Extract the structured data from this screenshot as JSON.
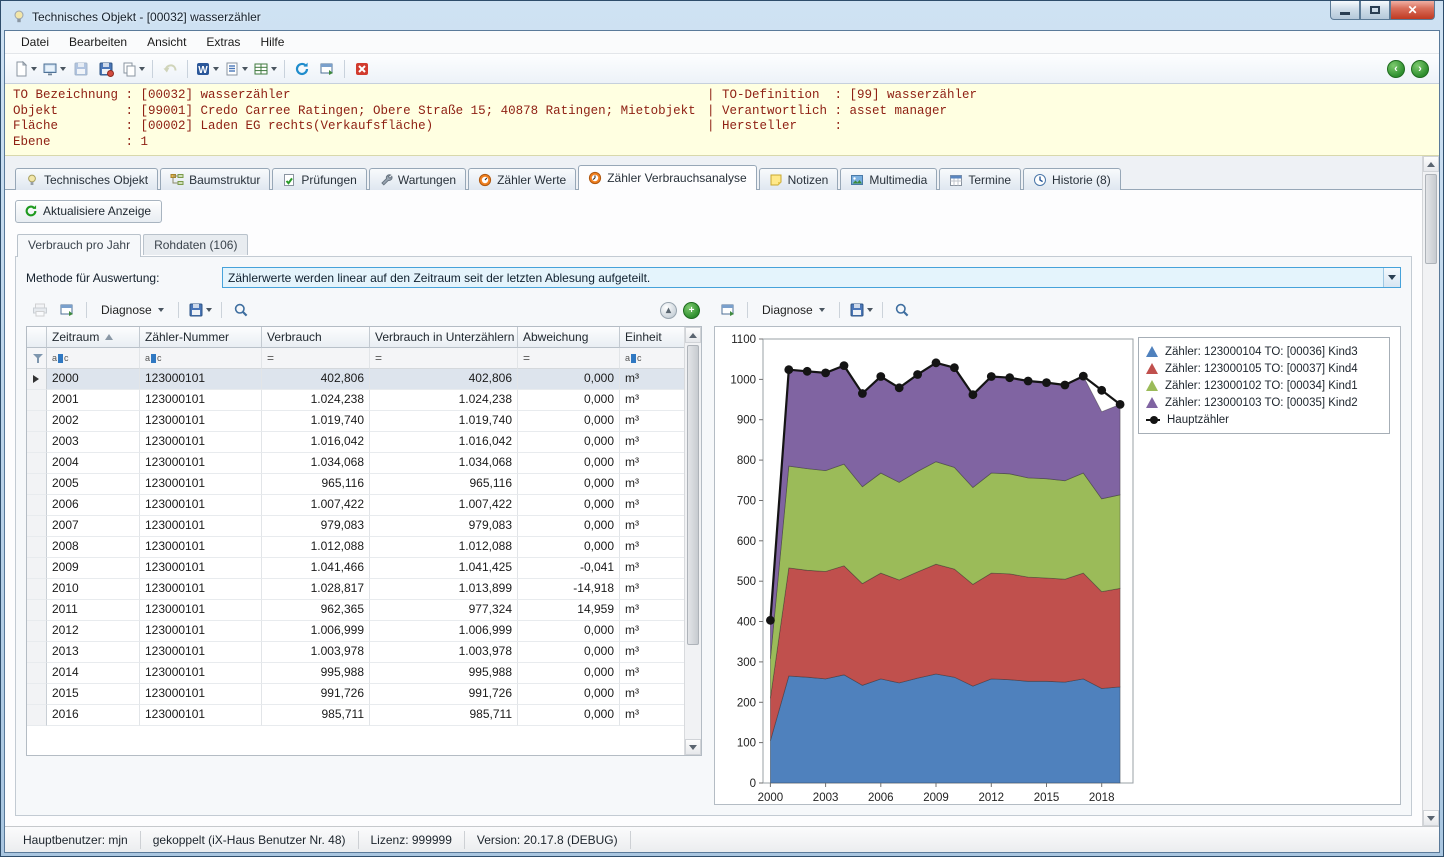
{
  "window": {
    "title": "Technisches Objekt - [00032] wasserzähler"
  },
  "menu": {
    "items": [
      "Datei",
      "Bearbeiten",
      "Ansicht",
      "Extras",
      "Hilfe"
    ]
  },
  "info_panel": {
    "lines": [
      {
        "left": "TO Bezeichnung : [00032] wasserzähler",
        "right": "| TO-Definition  : [99] wasserzähler"
      },
      {
        "left": "Objekt         : [99001] Credo Carree Ratingen; Obere Straße 15; 40878 Ratingen; Mietobjekt",
        "right": "| Verantwortlich : asset manager"
      },
      {
        "left": "Fläche         : [00002] Laden EG rechts(Verkaufsfläche)",
        "right": "| Hersteller     :"
      },
      {
        "left": "Ebene          : 1",
        "right": ""
      }
    ]
  },
  "tabs": [
    {
      "label": "Technisches Objekt",
      "icon": "lightbulb-icon",
      "active": false
    },
    {
      "label": "Baumstruktur",
      "icon": "tree-icon",
      "active": false
    },
    {
      "label": "Prüfungen",
      "icon": "checklist-icon",
      "active": false
    },
    {
      "label": "Wartungen",
      "icon": "wrench-icon",
      "active": false
    },
    {
      "label": "Zähler Werte",
      "icon": "gauge-icon",
      "active": false
    },
    {
      "label": "Zähler Verbrauchsanalyse",
      "icon": "gauge-icon",
      "active": true
    },
    {
      "label": "Notizen",
      "icon": "note-icon",
      "active": false
    },
    {
      "label": "Multimedia",
      "icon": "media-icon",
      "active": false
    },
    {
      "label": "Termine",
      "icon": "calendar-icon",
      "active": false
    },
    {
      "label": "Historie (8)",
      "icon": "clock-icon",
      "active": false
    }
  ],
  "page": {
    "refresh_label": "Aktualisiere Anzeige"
  },
  "subtabs": [
    {
      "label": "Verbrauch pro Jahr",
      "active": true
    },
    {
      "label": "Rohdaten (106)",
      "active": false
    }
  ],
  "method": {
    "label": "Methode für Auswertung:",
    "value": "Zählerwerte werden linear auf den Zeitraum seit der letzten Ablesung aufgeteilt."
  },
  "table_toolbar": {
    "diagnose_label": "Diagnose"
  },
  "chart_toolbar": {
    "diagnose_label": "Diagnose"
  },
  "table": {
    "columns": [
      "Zeitraum",
      "Zähler-Nummer",
      "Verbrauch",
      "Verbrauch in Unterzählern",
      "Abweichung",
      "Einheit"
    ],
    "rows": [
      {
        "period": "2000",
        "meter": "123000101",
        "value": "402,806",
        "sub": "402,806",
        "dev": "0,000",
        "unit": "m³",
        "selected": true
      },
      {
        "period": "2001",
        "meter": "123000101",
        "value": "1.024,238",
        "sub": "1.024,238",
        "dev": "0,000",
        "unit": "m³"
      },
      {
        "period": "2002",
        "meter": "123000101",
        "value": "1.019,740",
        "sub": "1.019,740",
        "dev": "0,000",
        "unit": "m³"
      },
      {
        "period": "2003",
        "meter": "123000101",
        "value": "1.016,042",
        "sub": "1.016,042",
        "dev": "0,000",
        "unit": "m³"
      },
      {
        "period": "2004",
        "meter": "123000101",
        "value": "1.034,068",
        "sub": "1.034,068",
        "dev": "0,000",
        "unit": "m³"
      },
      {
        "period": "2005",
        "meter": "123000101",
        "value": "965,116",
        "sub": "965,116",
        "dev": "0,000",
        "unit": "m³"
      },
      {
        "period": "2006",
        "meter": "123000101",
        "value": "1.007,422",
        "sub": "1.007,422",
        "dev": "0,000",
        "unit": "m³"
      },
      {
        "period": "2007",
        "meter": "123000101",
        "value": "979,083",
        "sub": "979,083",
        "dev": "0,000",
        "unit": "m³"
      },
      {
        "period": "2008",
        "meter": "123000101",
        "value": "1.012,088",
        "sub": "1.012,088",
        "dev": "0,000",
        "unit": "m³"
      },
      {
        "period": "2009",
        "meter": "123000101",
        "value": "1.041,466",
        "sub": "1.041,425",
        "dev": "-0,041",
        "unit": "m³"
      },
      {
        "period": "2010",
        "meter": "123000101",
        "value": "1.028,817",
        "sub": "1.013,899",
        "dev": "-14,918",
        "unit": "m³"
      },
      {
        "period": "2011",
        "meter": "123000101",
        "value": "962,365",
        "sub": "977,324",
        "dev": "14,959",
        "unit": "m³"
      },
      {
        "period": "2012",
        "meter": "123000101",
        "value": "1.006,999",
        "sub": "1.006,999",
        "dev": "0,000",
        "unit": "m³"
      },
      {
        "period": "2013",
        "meter": "123000101",
        "value": "1.003,978",
        "sub": "1.003,978",
        "dev": "0,000",
        "unit": "m³"
      },
      {
        "period": "2014",
        "meter": "123000101",
        "value": "995,988",
        "sub": "995,988",
        "dev": "0,000",
        "unit": "m³"
      },
      {
        "period": "2015",
        "meter": "123000101",
        "value": "991,726",
        "sub": "991,726",
        "dev": "0,000",
        "unit": "m³"
      },
      {
        "period": "2016",
        "meter": "123000101",
        "value": "985,711",
        "sub": "985,711",
        "dev": "0,000",
        "unit": "m³"
      }
    ]
  },
  "chart_data": {
    "type": "area",
    "stacked": true,
    "x": [
      2000,
      2001,
      2002,
      2003,
      2004,
      2005,
      2006,
      2007,
      2008,
      2009,
      2010,
      2011,
      2012,
      2013,
      2014,
      2015,
      2016,
      2017,
      2018,
      2019
    ],
    "series": [
      {
        "name": "Zähler: 123000104 TO: [00036] Kind3",
        "color": "#4f81bd",
        "values": [
          105,
          265,
          262,
          258,
          268,
          242,
          258,
          248,
          260,
          270,
          262,
          240,
          258,
          256,
          252,
          252,
          250,
          258,
          234,
          238
        ]
      },
      {
        "name": "Zähler: 123000105 TO: [00037] Kind4",
        "color": "#c0504d",
        "values": [
          105,
          268,
          265,
          266,
          270,
          252,
          262,
          255,
          263,
          272,
          268,
          252,
          262,
          262,
          258,
          256,
          255,
          262,
          240,
          244
        ]
      },
      {
        "name": "Zähler: 123000102 TO: [00034] Kind1",
        "color": "#9bbb59",
        "values": [
          98,
          252,
          252,
          250,
          252,
          240,
          248,
          242,
          249,
          254,
          252,
          240,
          248,
          248,
          246,
          246,
          244,
          248,
          230,
          232
        ]
      },
      {
        "name": "Zähler: 123000103 TO: [00035] Kind2",
        "color": "#8064a2",
        "values": [
          95,
          239,
          241,
          242,
          244,
          231,
          239,
          234,
          240,
          245,
          247,
          230,
          239,
          238,
          240,
          238,
          237,
          240,
          216,
          224
        ]
      }
    ],
    "line_series": {
      "name": "Hauptzähler",
      "color": "#141414",
      "values": [
        403,
        1024,
        1020,
        1016,
        1034,
        965,
        1007,
        979,
        1012,
        1041,
        1029,
        962,
        1007,
        1004,
        996,
        992,
        986,
        1008,
        973,
        938
      ]
    },
    "ylim": [
      0,
      1100
    ],
    "yticks": [
      0,
      100,
      200,
      300,
      400,
      500,
      600,
      700,
      800,
      900,
      1000,
      1100
    ],
    "xticks": [
      2000,
      2003,
      2006,
      2009,
      2012,
      2015,
      2018
    ],
    "legend_position": "top-right",
    "grid": false
  },
  "status_bar": {
    "items": [
      "Hauptbenutzer: mjn",
      "gekoppelt (iX-Haus Benutzer Nr. 48)",
      "Lizenz: 999999",
      "Version: 20.17.8 (DEBUG)"
    ]
  }
}
